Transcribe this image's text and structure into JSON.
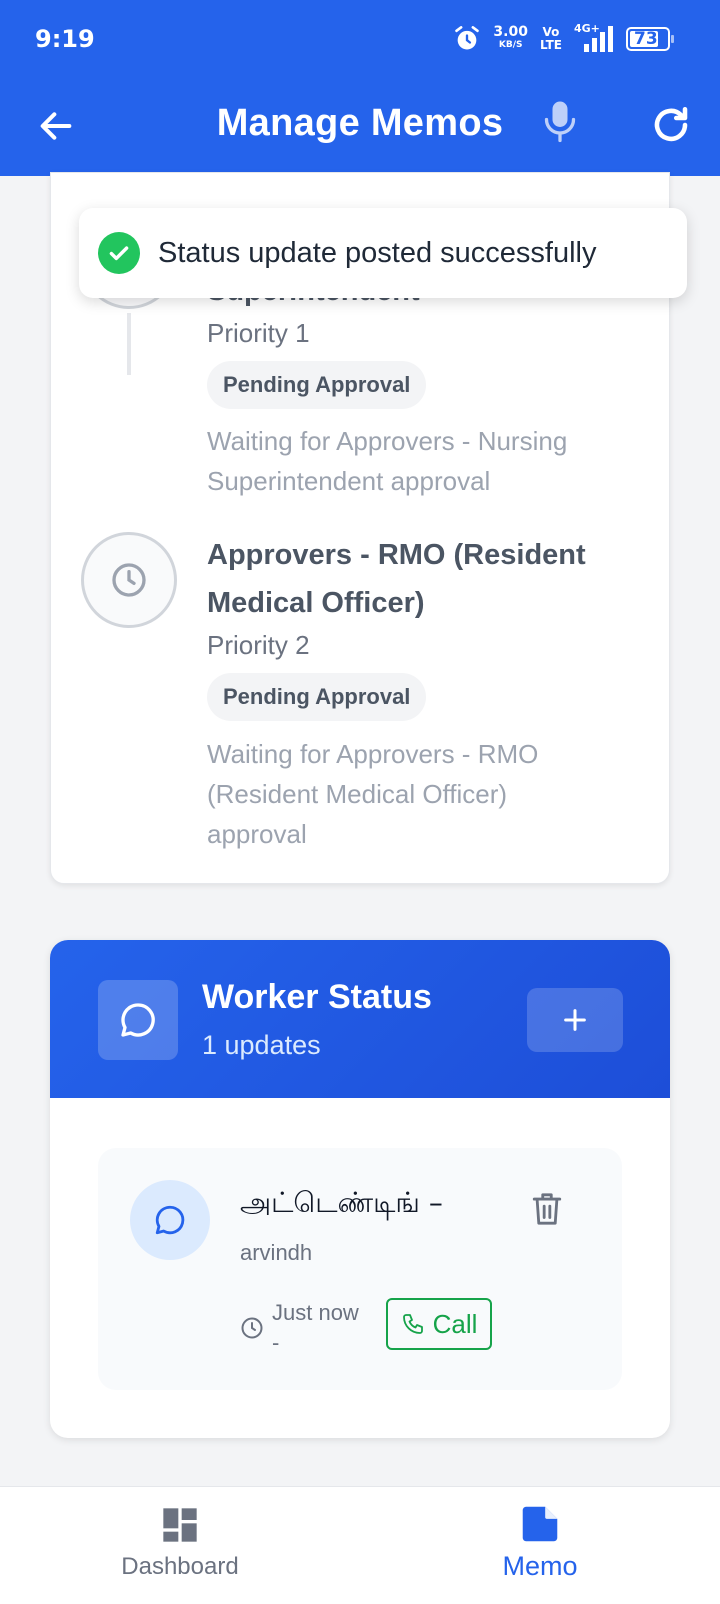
{
  "status_bar": {
    "time": "9:19",
    "net_speed": "3.00",
    "net_speed_unit": "KB/S",
    "volte_top": "Vo",
    "volte_bottom": "LTE",
    "network": "4G+",
    "battery": "73",
    "icons": [
      "alarm-icon",
      "signal-icon",
      "battery-icon"
    ]
  },
  "app_bar": {
    "title": "Manage Memos",
    "icons": [
      "back-arrow-icon",
      "microphone-icon",
      "refresh-icon"
    ]
  },
  "toast": {
    "message": "Status update posted successfully",
    "icon": "check-circle-icon",
    "color": "#22c55e"
  },
  "approvals": {
    "steps": [
      {
        "title": "Superintendent",
        "priority": "Priority 1",
        "status": "Pending Approval",
        "note": "Waiting for Approvers - Nursing Superintendent approval"
      },
      {
        "title": "Approvers - RMO (Resident Medical Officer)",
        "priority": "Priority 2",
        "status": "Pending Approval",
        "note": "Waiting for Approvers - RMO (Resident Medical Officer) approval"
      }
    ]
  },
  "worker_status": {
    "title": "Worker Status",
    "count_label": "1 updates",
    "add_label": "+",
    "accent": "#2563eb",
    "updates": [
      {
        "title": "அட்டெண்டிங் –",
        "author": "arvindh",
        "time": "Just now",
        "time_suffix": "-",
        "call_label": "Call"
      }
    ]
  },
  "bottom_nav": {
    "items": [
      {
        "label": "Dashboard",
        "icon": "dashboard-icon",
        "active": false
      },
      {
        "label": "Memo",
        "icon": "memo-icon",
        "active": true
      }
    ],
    "active_color": "#2563eb",
    "inactive_color": "#6b7280"
  }
}
